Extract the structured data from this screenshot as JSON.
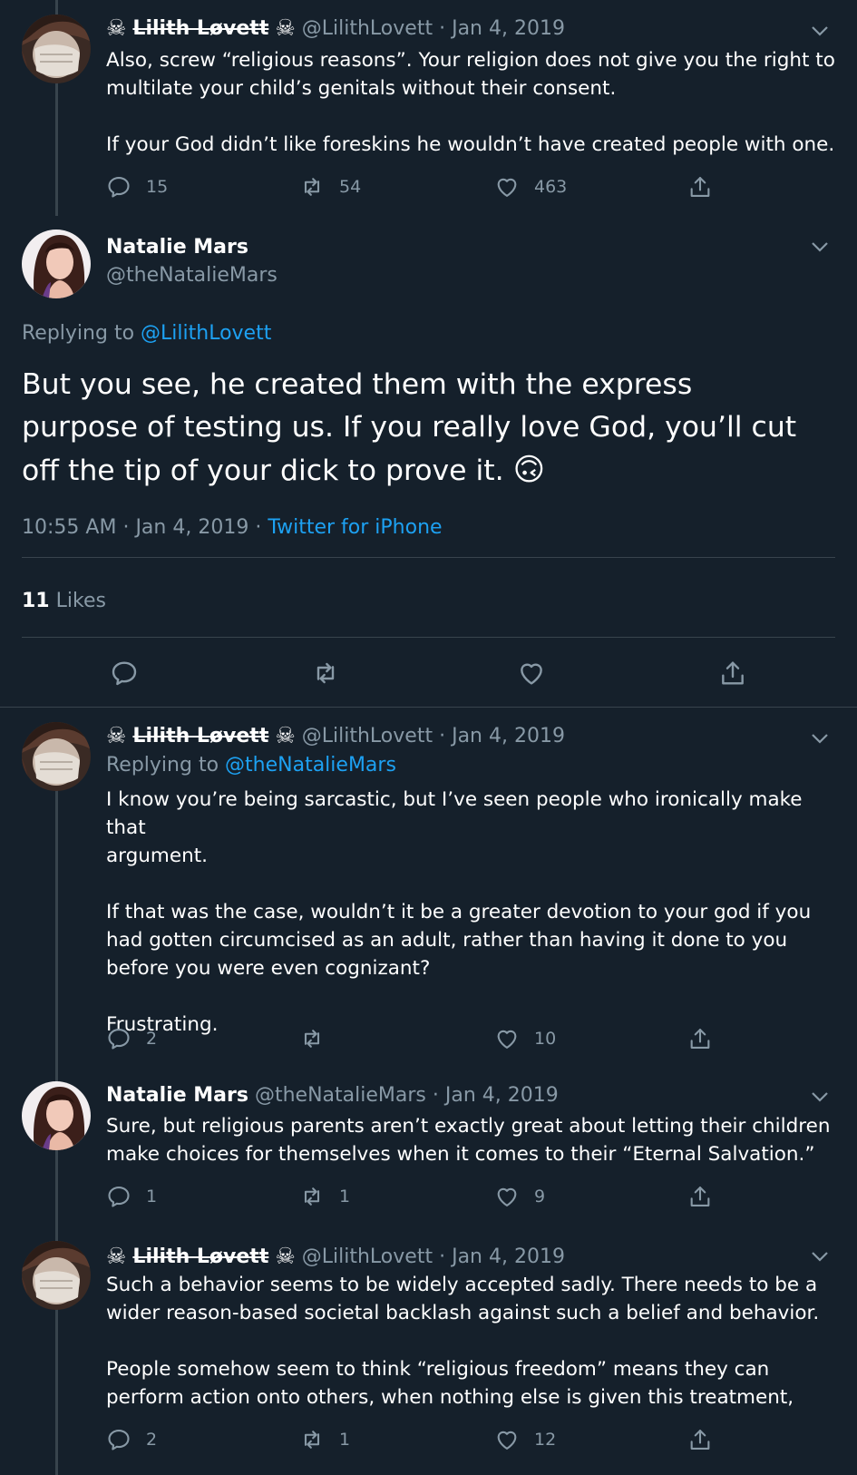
{
  "tweets": [
    {
      "display_name": "Lilith Løvett",
      "name_decoration": "☠",
      "handle": "@LilithLovett",
      "sep": "·",
      "date": "Jan 4, 2019",
      "lines": [
        "Also, screw “religious reasons”. Your religion does not give you the right to",
        "multilate your child’s genitals without their consent.",
        "",
        "If your God didn’t like foreskins he wouldn’t have created people with one."
      ],
      "replies": "15",
      "retweets": "54",
      "likes": "463"
    },
    {
      "display_name": "Lilith Løvett",
      "name_decoration": "☠",
      "handle": "@LilithLovett",
      "sep": "·",
      "date": "Jan 4, 2019",
      "replying_label": "Replying to",
      "replying_to": "@theNatalieMars",
      "lines": [
        "I know you’re being sarcastic, but I’ve seen people who ironically make that",
        "argument.",
        "",
        "If that was the case, wouldn’t it be a greater devotion to your god if you",
        "had gotten circumcised as an adult, rather than having it done to you",
        "before you were even cognizant?",
        "",
        "Frustrating."
      ],
      "replies": "2",
      "retweets": "",
      "likes": "10"
    },
    {
      "display_name": "Natalie Mars",
      "handle": "@theNatalieMars",
      "sep": "·",
      "date": "Jan 4, 2019",
      "lines": [
        "Sure, but religious parents aren’t exactly great about letting their children",
        "make choices for themselves when it comes to their “Eternal Salvation.”"
      ],
      "replies": "1",
      "retweets": "1",
      "likes": "9"
    },
    {
      "display_name": "Lilith Løvett",
      "name_decoration": "☠",
      "handle": "@LilithLovett",
      "sep": "·",
      "date": "Jan 4, 2019",
      "lines": [
        "Such a behavior seems to be widely accepted sadly. There needs to be a",
        "wider reason-based societal backlash against such a belief and behavior.",
        "",
        "People somehow seem to think “religious freedom” means they can",
        "perform action onto others, when nothing else is given this treatment,"
      ],
      "replies": "2",
      "retweets": "1",
      "likes": "12"
    }
  ],
  "focused": {
    "display_name": "Natalie Mars",
    "handle": "@theNatalieMars",
    "replying_label": "Replying to",
    "replying_to": "@LilithLovett",
    "lines": [
      "But you see, he created them with the express",
      "purpose of testing us. If you really love God, you’ll cut",
      "off the tip of your dick to prove it."
    ],
    "emoji": "🙃",
    "time": "10:55 AM",
    "sep": "·",
    "date": "Jan 4, 2019",
    "source": "Twitter for iPhone",
    "likes_count": "11",
    "likes_label": "Likes"
  },
  "colors": {
    "background": "#15202b",
    "muted": "#8899a6",
    "link": "#1da1f2",
    "divider": "#38444d"
  },
  "icons": [
    "reply-icon",
    "retweet-icon",
    "like-icon",
    "share-icon",
    "chevron-down-icon",
    "skull-crossbones-icon"
  ]
}
